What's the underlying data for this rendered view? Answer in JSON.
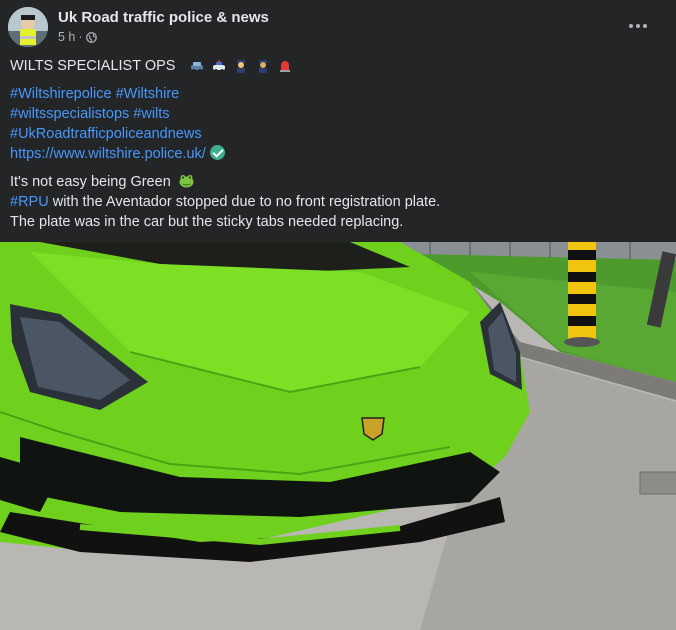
{
  "post": {
    "page_name": "Uk Road traffic police & news",
    "time": "5 h",
    "separator": "·",
    "privacy_icon": "globe-icon",
    "more_icon": "more-options-icon",
    "headline": "WILTS SPECIALIST OPS",
    "headline_emojis": [
      "police-car-light-icon",
      "police-car-icon",
      "police-officer-icon",
      "police-officer-icon",
      "rotating-light-icon"
    ],
    "hashtag_lines": [
      "#Wiltshirepolice #Wiltshire",
      "#wiltsspecialistops #wilts",
      "#UkRoadtrafficpoliceandnews"
    ],
    "url": "https://www.wiltshire.police.uk/",
    "url_badge_icon": "check-mark-icon",
    "body_line1": "It's not easy being Green",
    "body_line1_emoji": "frog-icon",
    "body_hashtag": "#RPU",
    "body_line2_rest": " with the Aventador stopped due to no front registration plate.",
    "body_line3": "The plate was in the car but the sticky tabs needed replacing."
  },
  "colors": {
    "background": "#242526",
    "text": "#e4e6eb",
    "secondary_text": "#b0b3b8",
    "link": "#4599ff",
    "car_green": "#6fd11e"
  }
}
